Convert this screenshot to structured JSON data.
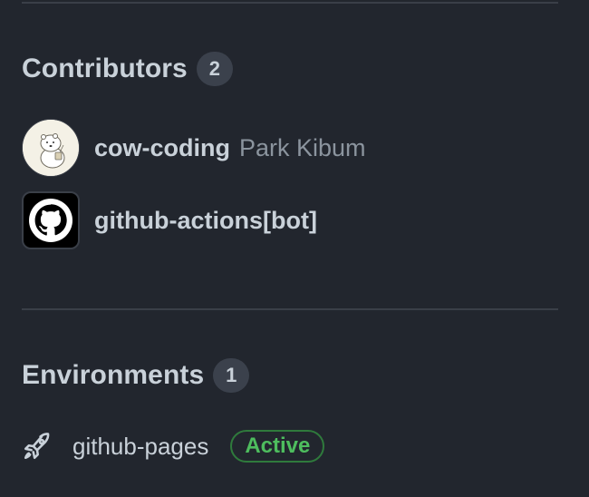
{
  "contributors": {
    "title": "Contributors",
    "count": "2",
    "items": [
      {
        "login": "cow-coding",
        "name": "Park Kibum",
        "avatar": "bear-avatar"
      },
      {
        "login": "github-actions[bot]",
        "name": "",
        "avatar": "github-octocat-icon"
      }
    ]
  },
  "environments": {
    "title": "Environments",
    "count": "1",
    "items": [
      {
        "name": "github-pages",
        "status": "Active",
        "icon": "rocket-icon"
      }
    ]
  },
  "colors": {
    "background": "#22262e",
    "text": "#c9d1d9",
    "muted": "#8b949e",
    "active_badge": "#4ebd5e"
  }
}
